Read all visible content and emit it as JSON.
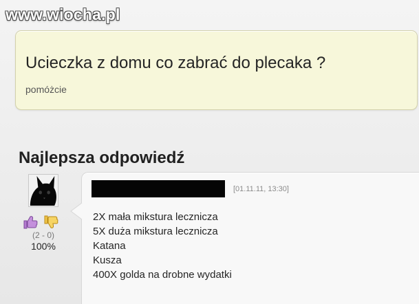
{
  "watermark": {
    "text": "www.wiocha.pl"
  },
  "question": {
    "title": "Ucieczka z domu co zabrać do plecaka ?",
    "subtitle": "pomóżcie"
  },
  "best_answer": {
    "heading_bold": "Najlepsza",
    "heading_rest": " odpowiedź",
    "timestamp": "[01.11.11, 13:30]",
    "lines": [
      "2X mała mikstura lecznicza",
      "5X duża mikstura lecznicza",
      "Katana",
      "Kusza",
      "400X golda na drobne wydatki"
    ]
  },
  "votes": {
    "counts": "(2 - 0)",
    "percent": "100%"
  },
  "colors": {
    "question_background": "#f7f7da",
    "answer_background": "#f8f8f8",
    "thumb_up": "#a66ac4",
    "thumb_down": "#e2b83f"
  },
  "icons": {
    "avatar": "black-cat-avatar",
    "vote_up": "thumb-up-icon",
    "vote_down": "thumb-down-icon"
  }
}
